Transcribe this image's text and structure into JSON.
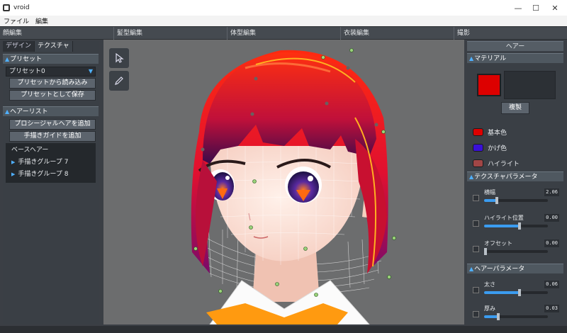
{
  "window": {
    "title": "vroid",
    "min": "—",
    "max": "☐",
    "close": "✕"
  },
  "menu": [
    "ファイル",
    "編集"
  ],
  "mode_tabs": [
    "顔編集",
    "髪型編集",
    "体型編集",
    "衣装編集",
    "撮影"
  ],
  "left": {
    "subtabs": [
      "デザイン",
      "テクスチャ"
    ],
    "preset": {
      "header": "プリセット",
      "selected": "プリセット0",
      "load": "プリセットから読み込み",
      "save": "プリセットとして保存"
    },
    "hairlist": {
      "header": "ヘアーリスト",
      "add_procedural": "プロシージャルヘアを追加",
      "add_guide": "手描きガイドを追加",
      "items": [
        "ベースヘアー",
        "手描きグループ 7",
        "手描きグループ 8"
      ]
    }
  },
  "right": {
    "title": "ヘアー",
    "material": {
      "header": "マテリアル",
      "copy": "複製",
      "colors": [
        {
          "label": "基本色",
          "color": "#dd0000"
        },
        {
          "label": "かげ色",
          "color": "#3a10d8"
        },
        {
          "label": "ハイライト",
          "color": "#a04646"
        }
      ],
      "main_color": "#dd0000"
    },
    "texture_params": {
      "header": "テクスチャパラメータ",
      "items": [
        {
          "label": "横幅",
          "value": "2.06",
          "level": 0.2
        },
        {
          "label": "ハイライト位置",
          "value": "0.00",
          "level": 0.8
        },
        {
          "label": "オフセット",
          "value": "0.00",
          "level": 0.0
        }
      ]
    },
    "hair_params": {
      "header": "ヘアーパラメータ",
      "items": [
        {
          "label": "太さ",
          "value": "0.06",
          "level": 0.8
        },
        {
          "label": "厚み",
          "value": "0.03",
          "level": 0.2
        }
      ]
    }
  },
  "tools": [
    "select-cursor-icon",
    "pen-icon"
  ]
}
